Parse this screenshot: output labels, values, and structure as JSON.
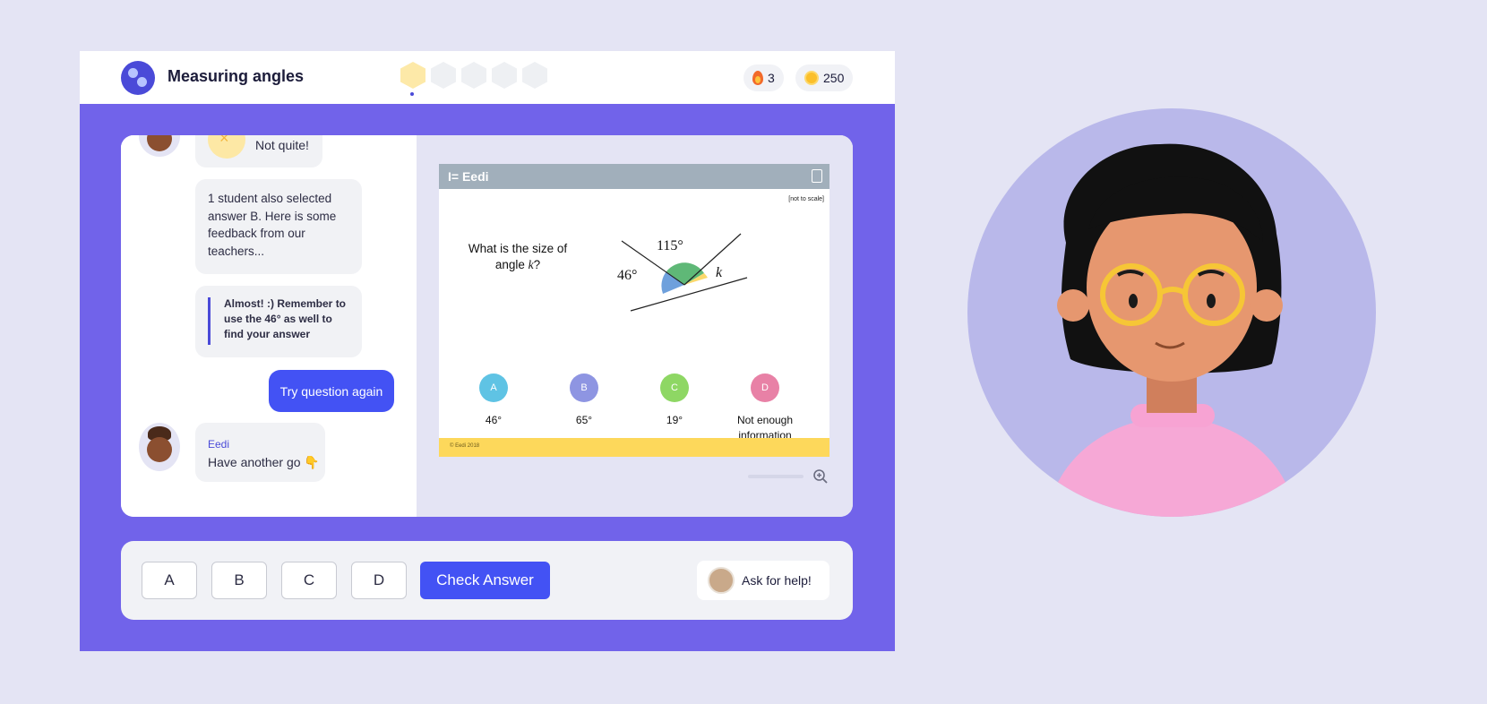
{
  "app": {
    "title": "Measuring angles",
    "streak": "3",
    "coins": "250",
    "progress_total": 5,
    "progress_current": 1
  },
  "chat": {
    "not_quite": "Not quite!",
    "info": "1 student also selected answer B. Here is some feedback from our teachers...",
    "feedback": "Almost! :) Remember to use the 46° as well to find your answer",
    "try_again": "Try question again",
    "eedi_name": "Eedi",
    "eedi_message": "Have another go 👇"
  },
  "question": {
    "brand": "I= Eedi",
    "scale_note": "[not to scale]",
    "text_prefix": "What is the size of angle ",
    "text_var": "k",
    "text_suffix": "?",
    "angle_115": "115°",
    "angle_46": "46°",
    "angle_k": "k",
    "options": [
      {
        "letter": "A",
        "text": "46°",
        "color": "#5fc3e4"
      },
      {
        "letter": "B",
        "text": "65°",
        "color": "#8e95e2"
      },
      {
        "letter": "C",
        "text": "19°",
        "color": "#8ed764"
      },
      {
        "letter": "D",
        "text": "Not enough information",
        "color": "#e881a6"
      }
    ],
    "copyright": "© Eedi 2018"
  },
  "answers": {
    "a": "A",
    "b": "B",
    "c": "C",
    "d": "D",
    "check": "Check Answer",
    "help": "Ask for help!"
  },
  "colors": {
    "brand_purple": "#7163ea",
    "primary_blue": "#4352f4",
    "background": "#e4e4f4"
  }
}
